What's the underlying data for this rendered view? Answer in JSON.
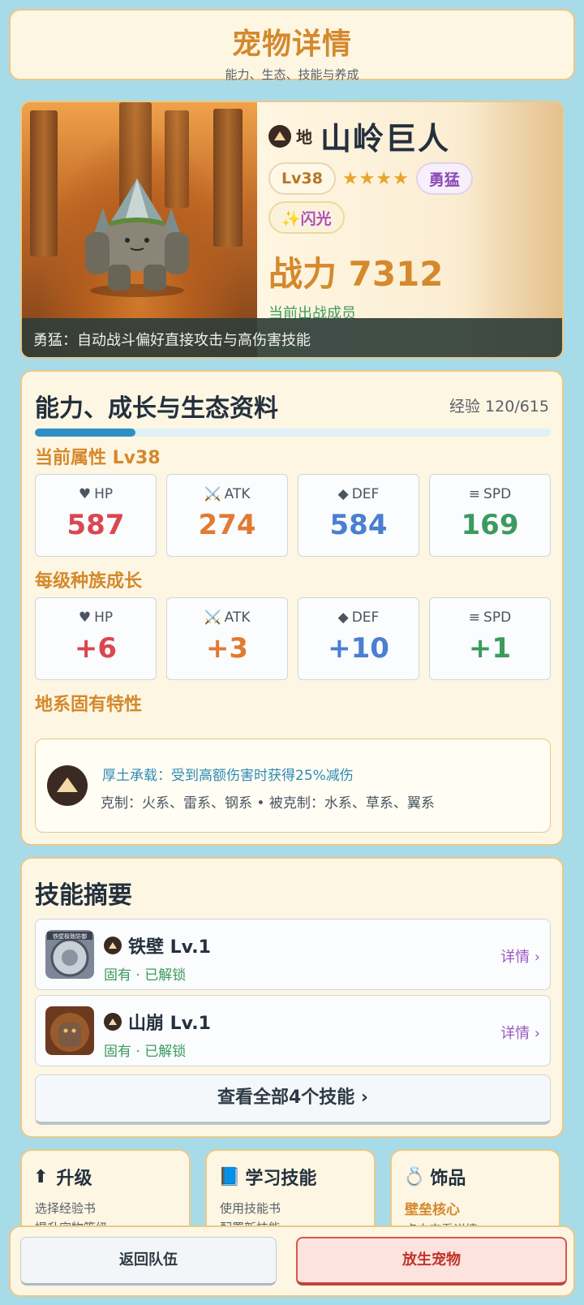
{
  "header": {
    "title": "宠物详情",
    "subtitle": "能力、生态、技能与养成"
  },
  "pet": {
    "element": "地",
    "name": "山岭巨人",
    "level_tag": "Lv38",
    "stars": "★★★★",
    "star_count": 4,
    "temperament": "勇猛",
    "shiny": "✨闪光",
    "power": "战力 7312",
    "status": "当前出战成员",
    "temperament_desc": "勇猛：自动战斗偏好直接攻击与高伤害技能"
  },
  "profile": {
    "title": "能力、成长与生态资料",
    "exp_text": "经验 120/615",
    "exp_fraction": 0.195,
    "current_title": "当前属性  Lv38",
    "current_stats": [
      {
        "icon": "♥",
        "label": "HP",
        "value": "587"
      },
      {
        "icon": "⚔️",
        "label": "ATK",
        "value": "274"
      },
      {
        "icon": "◆",
        "label": "DEF",
        "value": "584"
      },
      {
        "icon": "≡",
        "label": "SPD",
        "value": "169"
      }
    ],
    "growth_title": "每级种族成长",
    "growth_stats": [
      {
        "icon": "♥",
        "label": "HP",
        "value": "+6"
      },
      {
        "icon": "⚔️",
        "label": "ATK",
        "value": "+3"
      },
      {
        "icon": "◆",
        "label": "DEF",
        "value": "+10"
      },
      {
        "icon": "≡",
        "label": "SPD",
        "value": "+1"
      }
    ],
    "trait_title": "地系固有特性",
    "trait_text": "厚土承载：受到高额伤害时获得25%减伤",
    "relations": "克制：火系、雷系、钢系    •    被克制：水系、草系、翼系"
  },
  "skills": {
    "title": "技能摘要",
    "items": [
      {
        "name": "铁壁  Lv.1",
        "status": "固有 · 已解锁",
        "detail": "详情 ›",
        "img_text": "铁壁极致防御"
      },
      {
        "name": "山崩  Lv.1",
        "status": "固有 · 已解锁",
        "detail": "详情 ›"
      }
    ],
    "view_all": "查看全部4个技能 ›"
  },
  "actions": {
    "upgrade": {
      "icon": "⬆",
      "title": "升级",
      "line1": "选择经验书",
      "line2": "提升宠物等级"
    },
    "learn": {
      "icon": "📘",
      "title": "学习技能",
      "line1": "使用技能书",
      "line2": "配置新技能"
    },
    "accessory": {
      "icon": "💍",
      "title": "饰品",
      "accent": "壁垒核心",
      "line2": "点击查看详情"
    }
  },
  "bottom": {
    "back": "返回队伍",
    "release": "放生宠物"
  },
  "colors": {
    "accent": "#d4892c",
    "hp": "#d9484f",
    "atk": "#e17a33",
    "def": "#4a7fd1",
    "spd": "#3c9a5f",
    "danger": "#c0332a"
  }
}
